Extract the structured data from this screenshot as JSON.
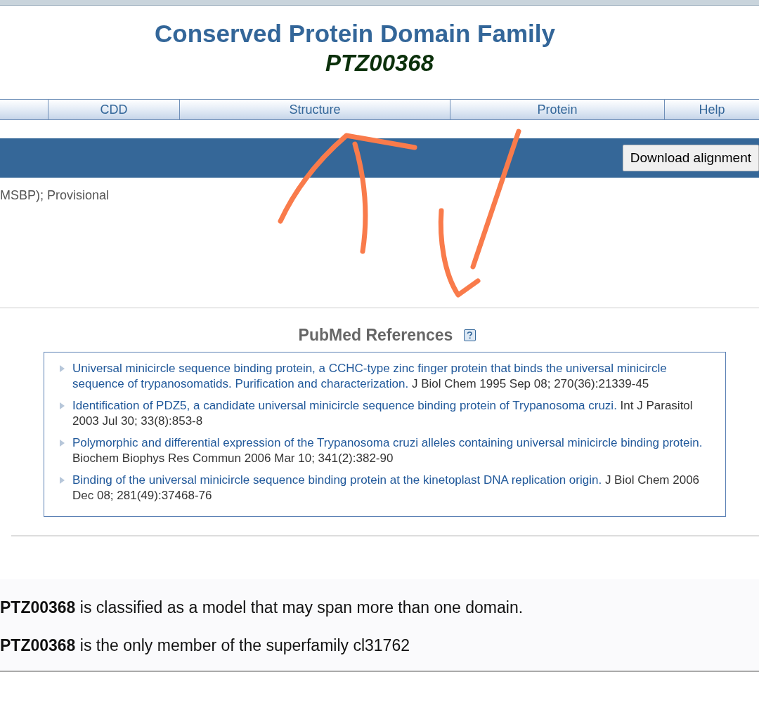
{
  "header": {
    "title": "Conserved Protein Domain Family",
    "accession": "PTZ00368"
  },
  "nav": {
    "tabs": [
      {
        "label": "CDD"
      },
      {
        "label": "Structure"
      },
      {
        "label": "Protein"
      },
      {
        "label": "Help"
      }
    ]
  },
  "toolbar": {
    "button": "Download alignment"
  },
  "description": "MSBP); Provisional",
  "references": {
    "heading": "PubMed References",
    "items": [
      {
        "title": "Universal minicircle sequence binding protein, a CCHC-type zinc finger protein that binds the universal minicircle sequence of trypanosomatids. Purification and characterization.",
        "citation": "J Biol Chem 1995 Sep 08; 270(36):21339-45"
      },
      {
        "title": "Identification of PDZ5, a candidate universal minicircle sequence binding protein of Trypanosoma cruzi.",
        "citation": "Int J Parasitol 2003 Jul 30; 33(8):853-8"
      },
      {
        "title": "Polymorphic and differential expression of the Trypanosoma cruzi alleles containing universal minicircle binding protein.",
        "citation": "Biochem Biophys Res Commun 2006 Mar 10; 341(2):382-90"
      },
      {
        "title": "Binding of the universal minicircle sequence binding protein at the kinetoplast DNA replication origin.",
        "citation": "J Biol Chem 2006 Dec 08; 281(49):37468-76"
      }
    ]
  },
  "notes": [
    "**PTZ00368** is classified as a model that may span more than one domain.",
    "**PTZ00368** is the only member of the superfamily cl31762"
  ]
}
